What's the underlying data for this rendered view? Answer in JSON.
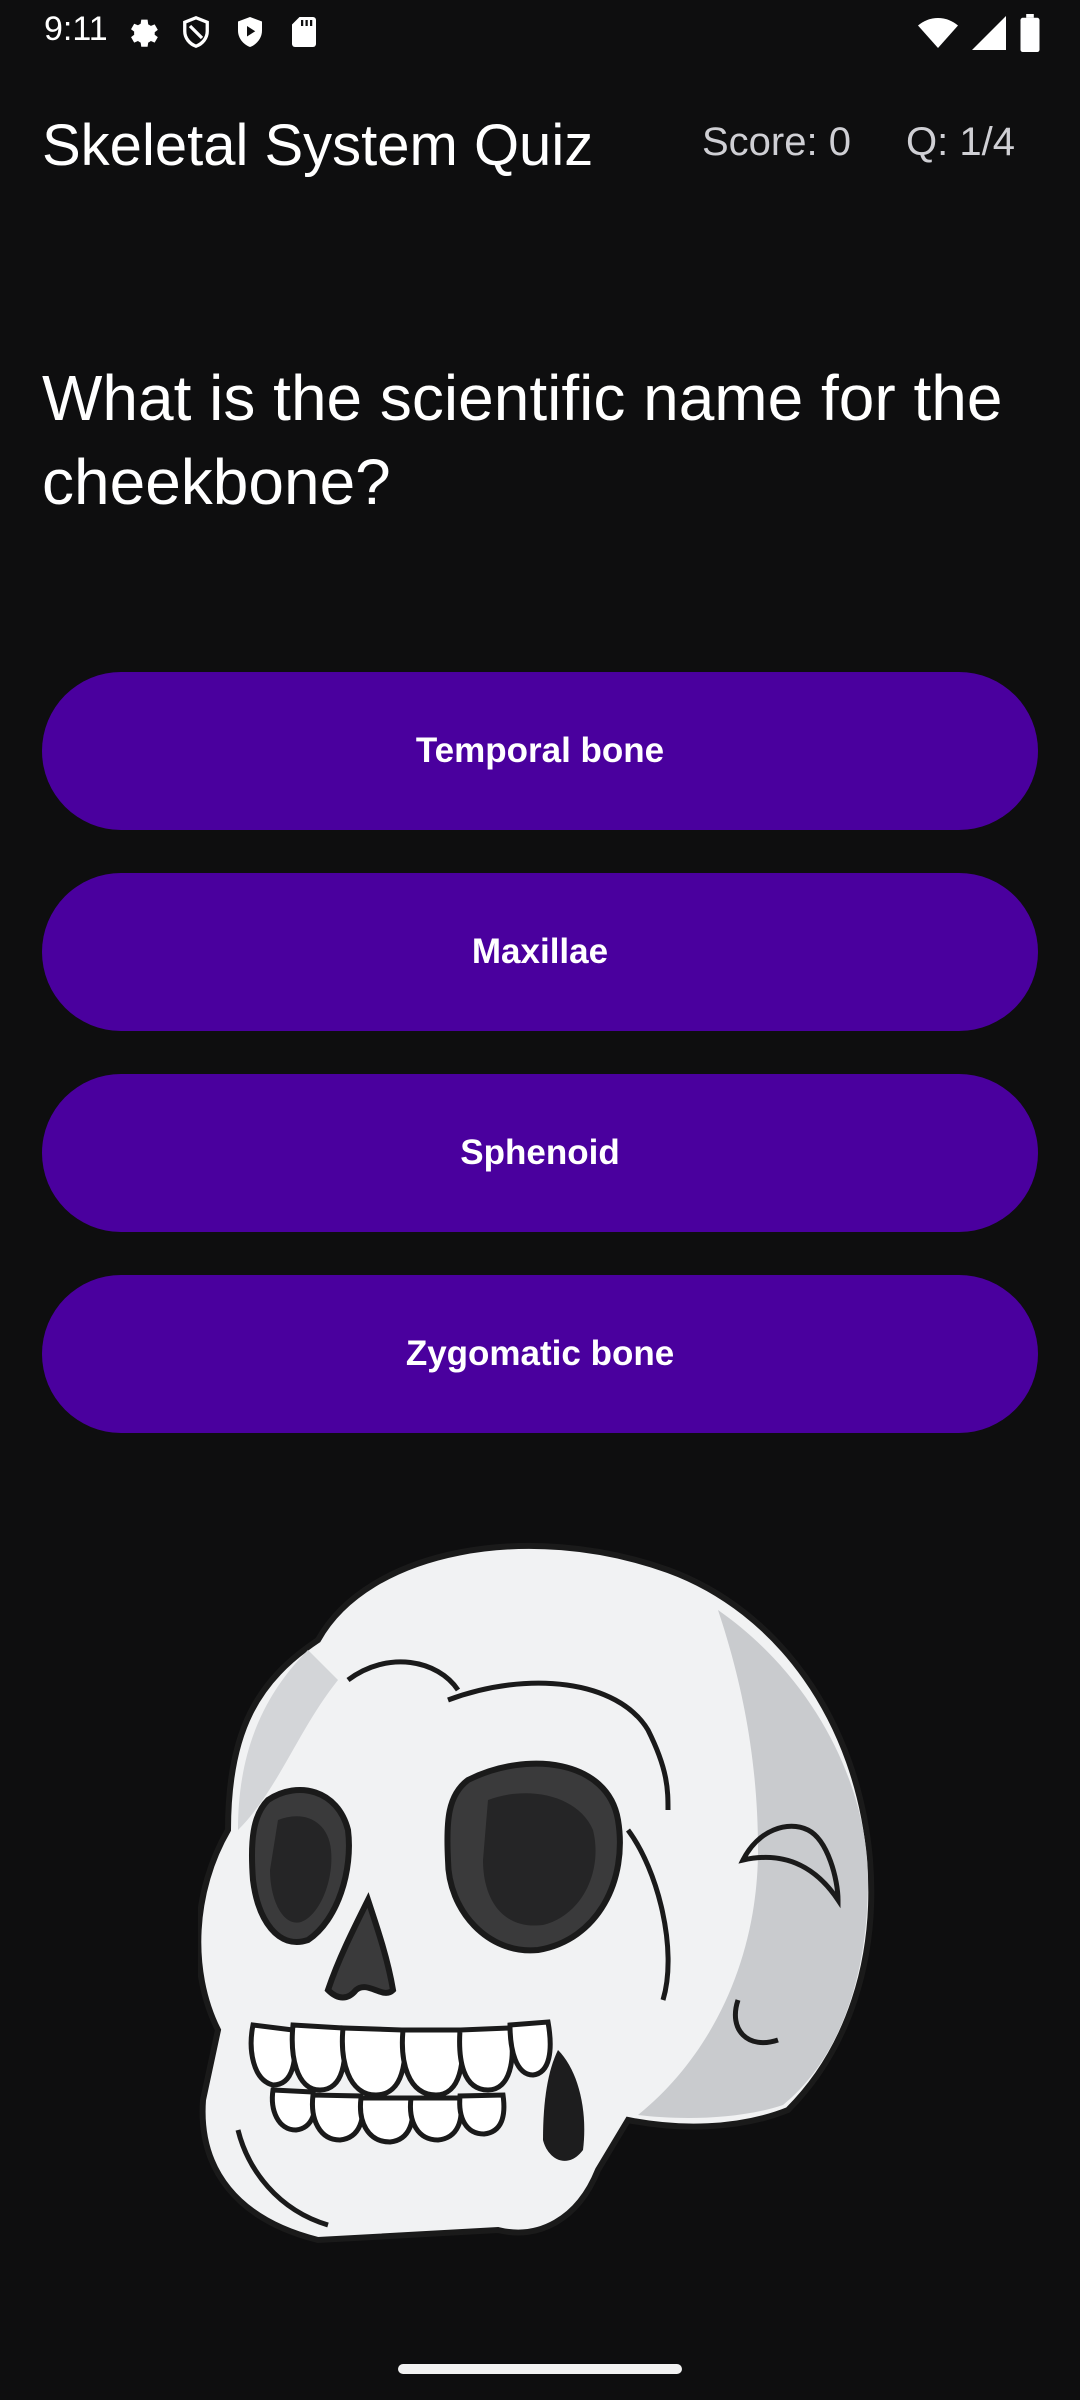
{
  "status_bar": {
    "time": "9:11",
    "left_icons": [
      "gear-icon",
      "shield-icon",
      "play-shield-icon",
      "sd-card-icon"
    ],
    "right_icons": [
      "wifi-icon",
      "signal-icon",
      "battery-icon"
    ]
  },
  "app_bar": {
    "title": "Skeletal System Quiz",
    "score": "Score: 0",
    "question_count": "Q: 1/4"
  },
  "question": {
    "text": "What is the scientific name for the cheekbone?"
  },
  "answers": [
    {
      "label": "Temporal bone"
    },
    {
      "label": "Maxillae"
    },
    {
      "label": "Sphenoid"
    },
    {
      "label": "Zygomatic bone"
    }
  ],
  "illustration": {
    "icon": "skull-illustration"
  },
  "colors": {
    "background": "#0e0e0f",
    "button": "#4a009e",
    "text": "#ffffff",
    "secondary_text": "#cfcfd4"
  }
}
